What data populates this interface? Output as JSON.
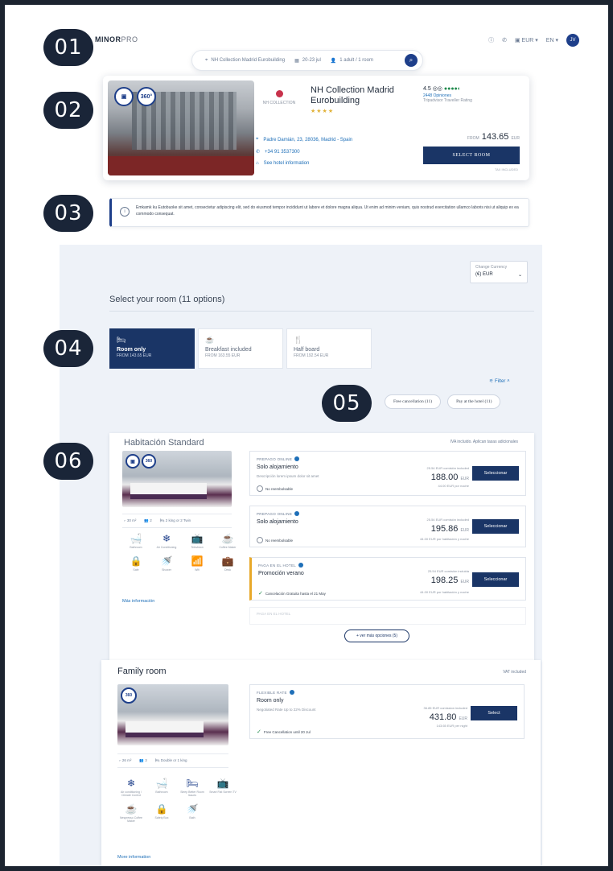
{
  "callouts": [
    "01",
    "02",
    "03",
    "04",
    "05",
    "06"
  ],
  "header": {
    "logo_bold": "MINOR",
    "logo_light": "PRO",
    "currency": "EUR",
    "language": "EN",
    "avatar": "JV",
    "icons": [
      "help-icon",
      "phone-icon",
      "wallet-icon"
    ]
  },
  "search": {
    "hotel": "NH Collection Madrid Eurobuilding",
    "dates": "20-23 jul",
    "guests": "1 adult / 1 room"
  },
  "hotel": {
    "brand": "NH COLLECTION",
    "name": "NH Collection Madrid Eurobuilding",
    "stars": "★★★★",
    "address": "Padre Damián, 23, 28036, Madrid - Spain",
    "phone": "+34 91 3537300",
    "info_link": "See hotel information",
    "rating": "4.5",
    "rating_dots": "●●●●◐",
    "reviews": "2448 Opiniones",
    "ranking": "Tripadvisor Traveller Rating",
    "from_label": "FROM",
    "price": "143.65",
    "price_currency": "EUR",
    "select_label": "SELECT ROOM",
    "tax_note": "TAX INCLUDED"
  },
  "notice": {
    "text": "Emkamk ku Eutobuoke sit amet, consectetur adipiscing elit, sed do eiusmod tempor incididunt ut labore et dolore magna aliqua. Ut enim ad minim veniam, quis nostrud exercitation ullamco laboris nisi ut aliquip ex ea commodo consequat."
  },
  "rooms_section": {
    "currency_label": "Change Currency",
    "currency_value": "(€) EUR",
    "title": "Select your room (11 options)",
    "tabs": [
      {
        "icon": "🛏",
        "label": "Room only",
        "from": "FROM 143.65 EUR"
      },
      {
        "icon": "☕",
        "label": "Breakfast included",
        "from": "FROM 163.55 EUR"
      },
      {
        "icon": "🍴",
        "label": "Half board",
        "from": "FROM 192.54 EUR"
      }
    ],
    "filter_label": "Filter",
    "chips": [
      "Free cancellation (11)",
      "Pay at the hotel (11)"
    ]
  },
  "room1": {
    "title": "Habitación Standard",
    "note": "IVA incluido. Aplican tasas adicionales",
    "specs": [
      "30 m²",
      "2",
      "2 king or 2 Twin"
    ],
    "amenities": [
      {
        "icon": "🛁",
        "label": "Bathroom"
      },
      {
        "icon": "❄",
        "label": "Air Conditioning"
      },
      {
        "icon": "📺",
        "label": "Television"
      },
      {
        "icon": "☕",
        "label": "Coffee Maker"
      },
      {
        "icon": "🔒",
        "label": "Safe"
      },
      {
        "icon": "🚿",
        "label": "Shower"
      },
      {
        "icon": "📶",
        "label": "Wifi"
      },
      {
        "icon": "💼",
        "label": "Desk"
      }
    ],
    "more_info": "Más información",
    "rates": [
      {
        "tag": "PREPAGO ONLINE",
        "name": "Solo alojamiento",
        "desc": "Descripción lorem ipsum dolor sit amet",
        "policy": "No reembolsable",
        "inc": "25.54 EUR comisión included",
        "price": "188.00",
        "cur": "EUR",
        "per": "44.00 EUR por noche",
        "btn": "Seleccionar"
      },
      {
        "tag": "PREPAGO ONLINE",
        "name": "Solo alojamiento",
        "desc": "",
        "policy": "No reembolsable",
        "inc": "25.54 EUR comisión included",
        "price": "195.86",
        "cur": "EUR",
        "per": "44.00 EUR por habitación y noche",
        "btn": "Seleccionar"
      },
      {
        "tag": "PAGA EN EL HOTEL",
        "name": "Promoción verano",
        "desc": "",
        "policy": "Cancelación Gratuita hasta el 21 May",
        "inc": "25.54 EUR comisión incluida",
        "price": "198.25",
        "cur": "EUR",
        "per": "44.00 EUR por habitación y noche",
        "btn": "Seleccionar"
      }
    ],
    "faded_tag": "PAGA EN EL HOTEL",
    "more_options": "+ ver más opciones (5)"
  },
  "room2": {
    "title": "Family room",
    "note": "VAT included",
    "specs": [
      "26 m²",
      "3",
      "Double or 1 king"
    ],
    "amenities": [
      {
        "icon": "❄",
        "label": "Air conditioning / Climate Control"
      },
      {
        "icon": "🛁",
        "label": "Bathroom"
      },
      {
        "icon": "🛏",
        "label": "Sleep Better Room Issues"
      },
      {
        "icon": "📺",
        "label": "Smart Flat Screen TV"
      },
      {
        "icon": "☕",
        "label": "Nespresso Coffee Maker"
      },
      {
        "icon": "🔒",
        "label": "Safety Box"
      },
      {
        "icon": "🚿",
        "label": "Bath"
      }
    ],
    "more_info": "More information",
    "rate": {
      "tag": "FLEXIBLE RATE",
      "name": "Room only",
      "desc": "Negotiated Rate Up to 22% Discount",
      "policy": "Free Cancellation until 20 Jul",
      "inc": "36.85 EUR comission included",
      "price": "431.80",
      "cur": "EUR",
      "per": "143.65 EUR per night",
      "btn": "Select"
    }
  }
}
